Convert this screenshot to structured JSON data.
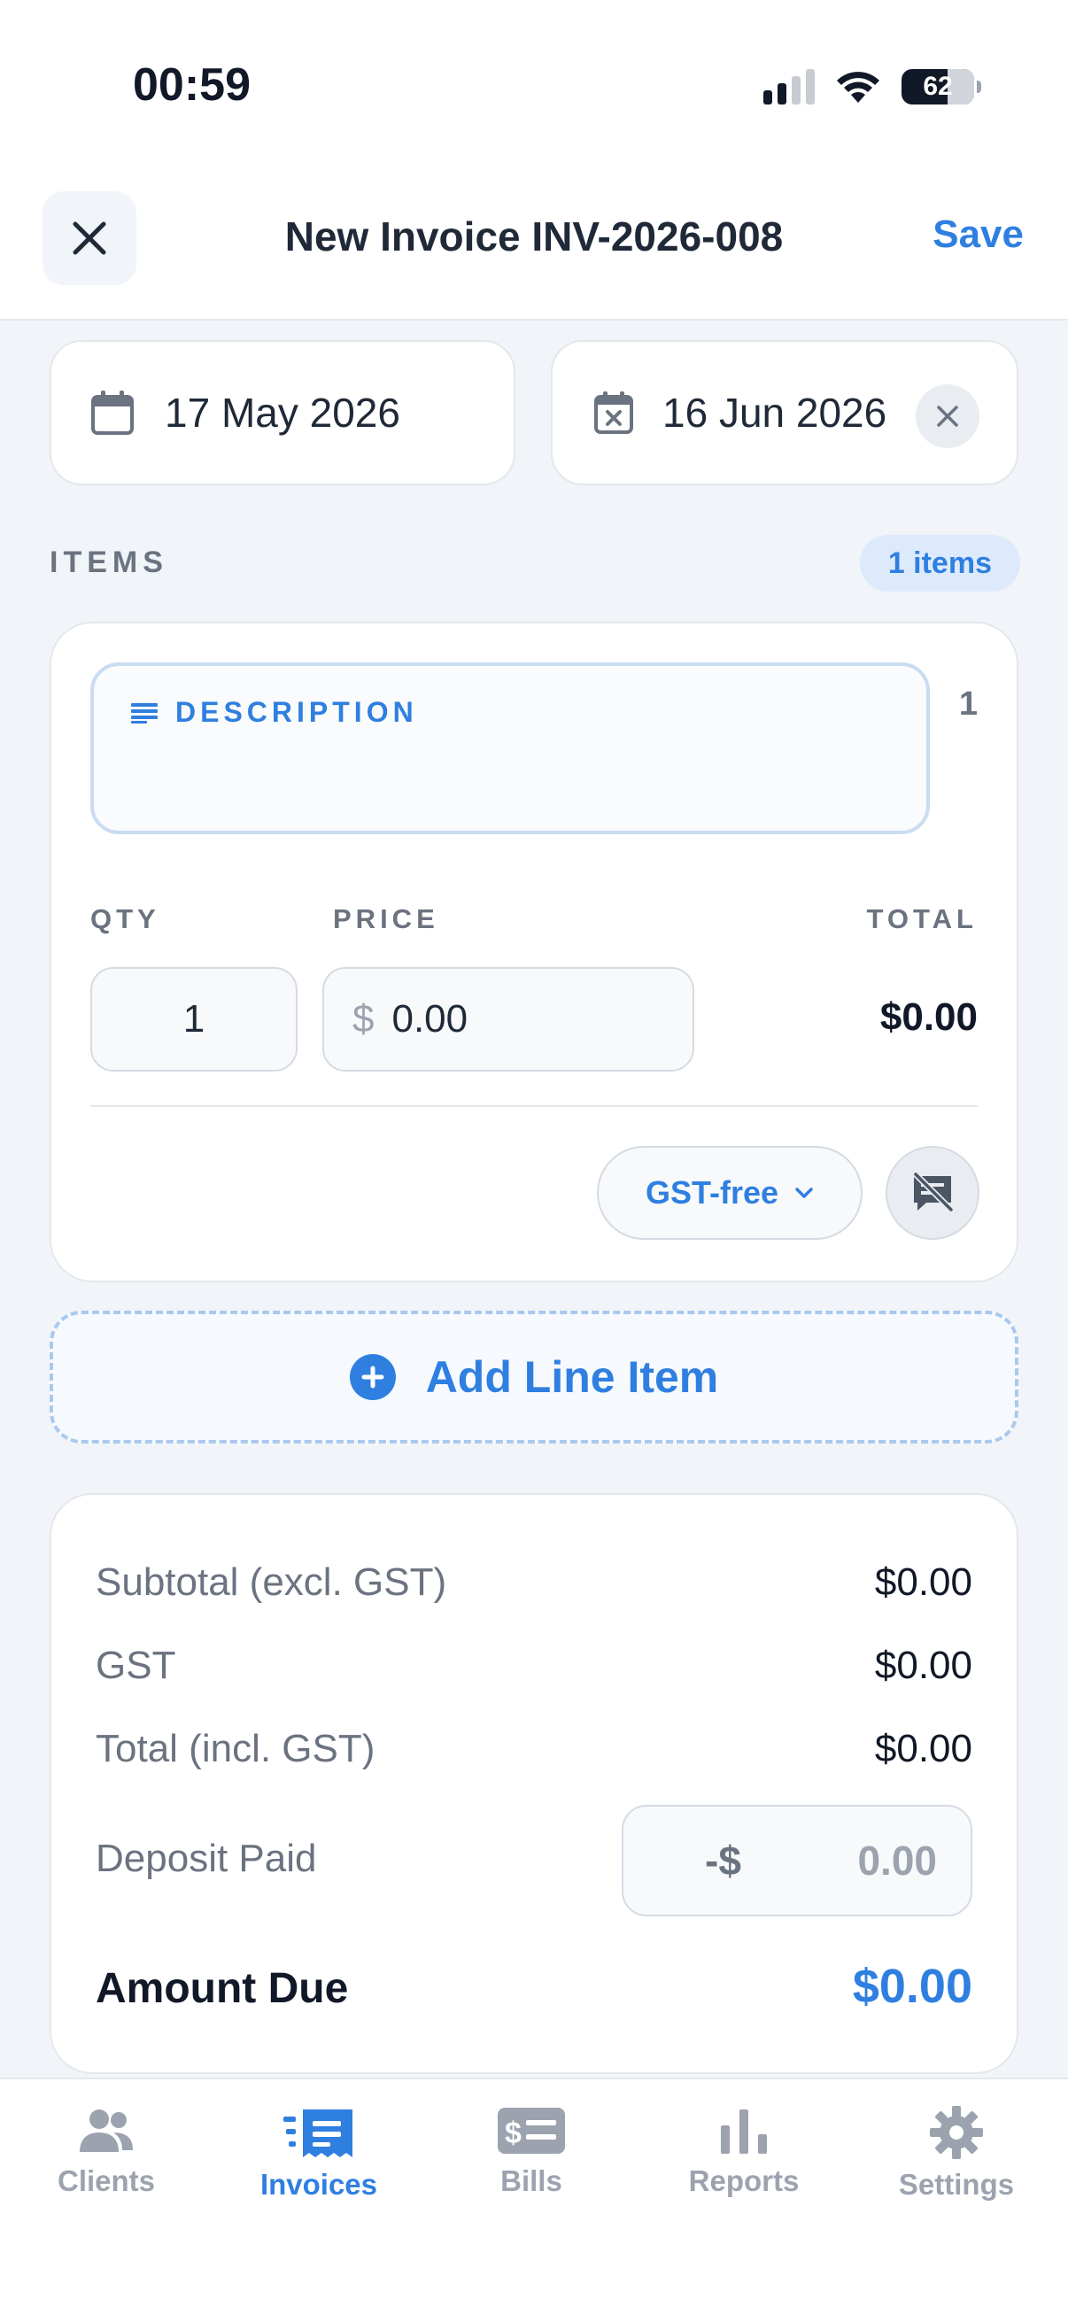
{
  "status": {
    "time": "00:59",
    "battery": "62"
  },
  "header": {
    "title": "New Invoice INV-2026-008",
    "save_label": "Save"
  },
  "dates": {
    "issue_date": "17 May 2026",
    "due_date": "16 Jun 2026"
  },
  "items_section": {
    "label": "ITEMS",
    "count_badge": "1 items",
    "items": [
      {
        "number": "1",
        "description_label": "DESCRIPTION",
        "description_value": "",
        "qty_label": "QTY",
        "price_label": "PRICE",
        "total_label": "TOTAL",
        "qty": "1",
        "currency": "$",
        "price": "0.00",
        "total": "$0.00",
        "tax_option": "GST-free"
      }
    ],
    "add_line_label": "Add Line Item"
  },
  "totals": {
    "subtotal_label": "Subtotal (excl. GST)",
    "subtotal": "$0.00",
    "gst_label": "GST",
    "gst": "$0.00",
    "total_label": "Total (incl. GST)",
    "total": "$0.00",
    "deposit_label": "Deposit Paid",
    "deposit_prefix": "-$",
    "deposit_value": "0.00",
    "amount_due_label": "Amount Due",
    "amount_due": "$0.00"
  },
  "tabbar": {
    "tabs": [
      {
        "label": "Clients",
        "icon": "users-icon"
      },
      {
        "label": "Invoices",
        "icon": "invoice-icon"
      },
      {
        "label": "Bills",
        "icon": "bill-icon"
      },
      {
        "label": "Reports",
        "icon": "bar-chart-icon"
      },
      {
        "label": "Settings",
        "icon": "gear-icon"
      }
    ],
    "active": "Invoices"
  },
  "colors": {
    "accent": "#2f7fe0",
    "muted": "#6b7280",
    "background": "#f1f4f8"
  }
}
